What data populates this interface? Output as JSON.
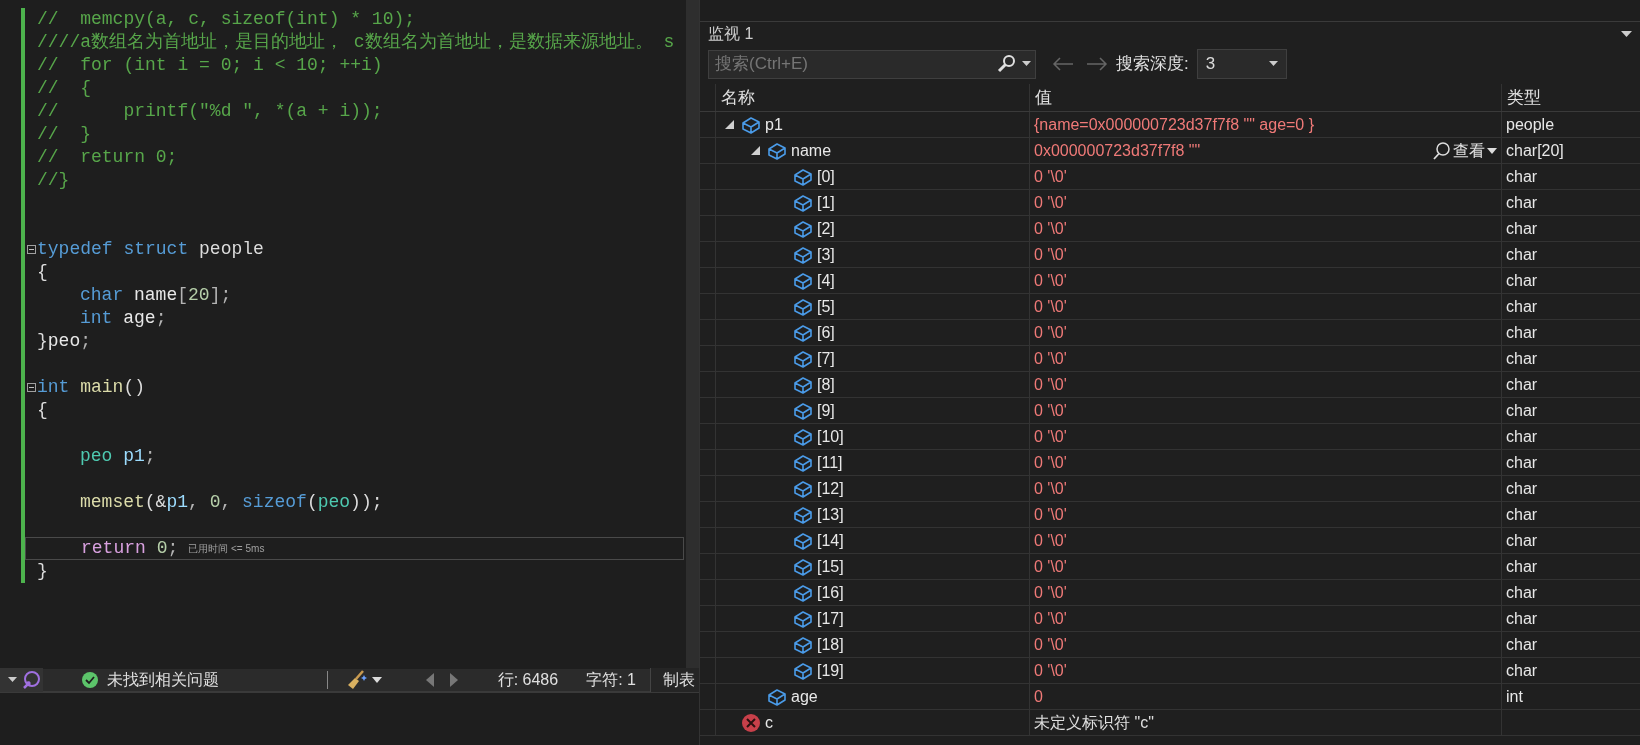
{
  "code_lines": [
    {
      "kind": "code",
      "tokens": [
        {
          "kind": "comment",
          "text": "//  memcpy(a, c, sizeof(int) * 10);"
        }
      ]
    },
    {
      "kind": "code",
      "tokens": [
        {
          "kind": "comment",
          "text": "////a数组名为首地址，是目的地址， c数组名为首地址，是数据来源地址。 s"
        }
      ]
    },
    {
      "kind": "code",
      "tokens": [
        {
          "kind": "comment",
          "text": "//  for (int i = 0; i < 10; ++i)"
        }
      ]
    },
    {
      "kind": "code",
      "tokens": [
        {
          "kind": "comment",
          "text": "//  {"
        }
      ]
    },
    {
      "kind": "code",
      "tokens": [
        {
          "kind": "comment",
          "text": "//      printf(\"%d \", *(a + i));"
        }
      ]
    },
    {
      "kind": "code",
      "tokens": [
        {
          "kind": "comment",
          "text": "//  }"
        }
      ]
    },
    {
      "kind": "code",
      "tokens": [
        {
          "kind": "comment",
          "text": "//  return 0;"
        }
      ]
    },
    {
      "kind": "code",
      "tokens": [
        {
          "kind": "comment",
          "text": "//}"
        }
      ]
    },
    {
      "kind": "blank"
    },
    {
      "kind": "blank"
    },
    {
      "kind": "code",
      "collapsible": true,
      "tokens": [
        {
          "kind": "keyword",
          "text": "typedef struct "
        },
        {
          "kind": "plain",
          "text": "people"
        }
      ]
    },
    {
      "kind": "code",
      "tokens": [
        {
          "kind": "plain",
          "text": "{"
        }
      ]
    },
    {
      "kind": "code",
      "indented": true,
      "tokens": [
        {
          "kind": "keyword",
          "text": "char "
        },
        {
          "kind": "ident",
          "text": "name"
        },
        {
          "kind": "punct",
          "text": "["
        },
        {
          "kind": "number",
          "text": "20"
        },
        {
          "kind": "punct",
          "text": "];"
        }
      ]
    },
    {
      "kind": "code",
      "indented": true,
      "tokens": [
        {
          "kind": "keyword",
          "text": "int "
        },
        {
          "kind": "ident",
          "text": "age"
        },
        {
          "kind": "punct",
          "text": ";"
        }
      ]
    },
    {
      "kind": "code",
      "tokens": [
        {
          "kind": "plain",
          "text": "}"
        },
        {
          "kind": "ident",
          "text": "peo"
        },
        {
          "kind": "punct",
          "text": ";"
        }
      ]
    },
    {
      "kind": "blank"
    },
    {
      "kind": "code",
      "collapsible": true,
      "tokens": [
        {
          "kind": "keyword",
          "text": "int "
        },
        {
          "kind": "func",
          "text": "main"
        },
        {
          "kind": "plain",
          "text": "()"
        }
      ]
    },
    {
      "kind": "code",
      "tokens": [
        {
          "kind": "plain",
          "text": "{"
        }
      ]
    },
    {
      "kind": "blank"
    },
    {
      "kind": "code",
      "indented": true,
      "tokens": [
        {
          "kind": "type",
          "text": "peo "
        },
        {
          "kind": "var",
          "text": "p1"
        },
        {
          "kind": "punct",
          "text": ";"
        }
      ]
    },
    {
      "kind": "blank"
    },
    {
      "kind": "code",
      "indented": true,
      "tokens": [
        {
          "kind": "func",
          "text": "memset"
        },
        {
          "kind": "plain",
          "text": "(&"
        },
        {
          "kind": "var",
          "text": "p1"
        },
        {
          "kind": "punct",
          "text": ", "
        },
        {
          "kind": "number",
          "text": "0"
        },
        {
          "kind": "punct",
          "text": ", "
        },
        {
          "kind": "keyword",
          "text": "sizeof"
        },
        {
          "kind": "plain",
          "text": "("
        },
        {
          "kind": "type",
          "text": "peo"
        },
        {
          "kind": "plain",
          "text": "));"
        }
      ]
    },
    {
      "kind": "blank"
    },
    {
      "kind": "code",
      "indented": true,
      "current": true,
      "hint": "已用时间 <= 5ms",
      "tokens": [
        {
          "kind": "control",
          "text": "return "
        },
        {
          "kind": "number",
          "text": "0"
        },
        {
          "kind": "punct",
          "text": ";"
        }
      ]
    },
    {
      "kind": "code",
      "tokens": [
        {
          "kind": "plain",
          "text": "}"
        }
      ]
    }
  ],
  "status_bar": {
    "issues": "未找到相关问题",
    "line": "行: 6486",
    "column": "字符: 1",
    "tab_mode": "制表"
  },
  "watch": {
    "title": "监视 1",
    "search": {
      "placeholder": "搜索(Ctrl+E)"
    },
    "depth_label": "搜索深度:",
    "depth": "3",
    "columns": [
      "名称",
      "值",
      "类型"
    ],
    "rows": [
      {
        "kind": "variable",
        "name": "p1",
        "expanded": true,
        "value": "{name=0x000000723d37f7f8 \"\" age=0 }",
        "changed": true,
        "type": "people",
        "children": [
          {
            "kind": "variable",
            "name": "name",
            "expanded": true,
            "value": "0x000000723d37f7f8 \"\"",
            "changed": true,
            "type": "char[20]",
            "visualizer": "查看",
            "children": [
              {
                "kind": "variable",
                "name": "[0]",
                "value": "0 '\\0'",
                "changed": true,
                "type": "char"
              },
              {
                "kind": "variable",
                "name": "[1]",
                "value": "0 '\\0'",
                "changed": true,
                "type": "char"
              },
              {
                "kind": "variable",
                "name": "[2]",
                "value": "0 '\\0'",
                "changed": true,
                "type": "char"
              },
              {
                "kind": "variable",
                "name": "[3]",
                "value": "0 '\\0'",
                "changed": true,
                "type": "char"
              },
              {
                "kind": "variable",
                "name": "[4]",
                "value": "0 '\\0'",
                "changed": true,
                "type": "char"
              },
              {
                "kind": "variable",
                "name": "[5]",
                "value": "0 '\\0'",
                "changed": true,
                "type": "char"
              },
              {
                "kind": "variable",
                "name": "[6]",
                "value": "0 '\\0'",
                "changed": true,
                "type": "char"
              },
              {
                "kind": "variable",
                "name": "[7]",
                "value": "0 '\\0'",
                "changed": true,
                "type": "char"
              },
              {
                "kind": "variable",
                "name": "[8]",
                "value": "0 '\\0'",
                "changed": true,
                "type": "char"
              },
              {
                "kind": "variable",
                "name": "[9]",
                "value": "0 '\\0'",
                "changed": true,
                "type": "char"
              },
              {
                "kind": "variable",
                "name": "[10]",
                "value": "0 '\\0'",
                "changed": true,
                "type": "char"
              },
              {
                "kind": "variable",
                "name": "[11]",
                "value": "0 '\\0'",
                "changed": true,
                "type": "char"
              },
              {
                "kind": "variable",
                "name": "[12]",
                "value": "0 '\\0'",
                "changed": true,
                "type": "char"
              },
              {
                "kind": "variable",
                "name": "[13]",
                "value": "0 '\\0'",
                "changed": true,
                "type": "char"
              },
              {
                "kind": "variable",
                "name": "[14]",
                "value": "0 '\\0'",
                "changed": true,
                "type": "char"
              },
              {
                "kind": "variable",
                "name": "[15]",
                "value": "0 '\\0'",
                "changed": true,
                "type": "char"
              },
              {
                "kind": "variable",
                "name": "[16]",
                "value": "0 '\\0'",
                "changed": true,
                "type": "char"
              },
              {
                "kind": "variable",
                "name": "[17]",
                "value": "0 '\\0'",
                "changed": true,
                "type": "char"
              },
              {
                "kind": "variable",
                "name": "[18]",
                "value": "0 '\\0'",
                "changed": true,
                "type": "char"
              },
              {
                "kind": "variable",
                "name": "[19]",
                "value": "0 '\\0'",
                "changed": true,
                "type": "char"
              }
            ]
          },
          {
            "kind": "variable",
            "name": "age",
            "value": "0",
            "changed": true,
            "type": "int"
          }
        ]
      },
      {
        "kind": "error",
        "name": "c",
        "value": "未定义标识符 \"c\"",
        "changed": false
      }
    ]
  }
}
